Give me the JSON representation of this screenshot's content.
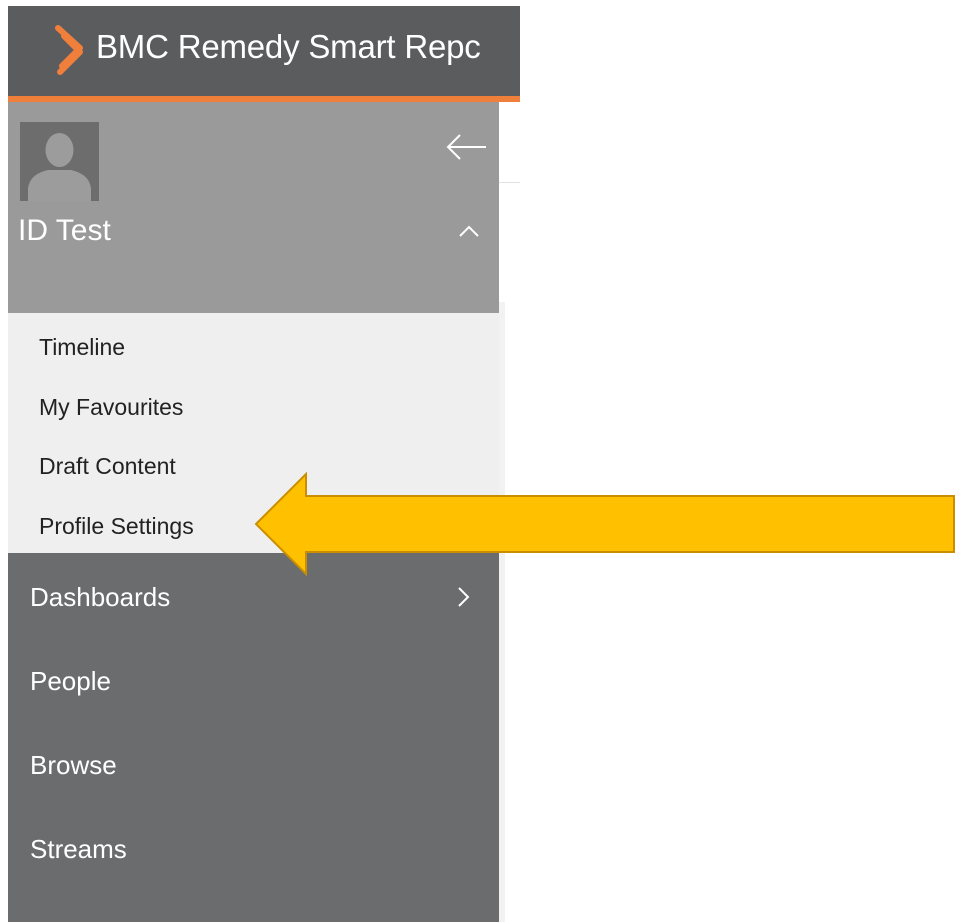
{
  "header": {
    "app_title": "BMC Remedy Smart Repc",
    "logo_icon": "bmc-chevron-logo-icon",
    "bar_color": "#5b5c5e",
    "accent_color": "#f07f3c"
  },
  "profile": {
    "user_name": "ID Test",
    "avatar_icon": "user-silhouette-icon",
    "collapse_icon": "arrow-left-icon",
    "toggle_icon": "chevron-up-icon"
  },
  "submenu": {
    "items": [
      {
        "label": "Timeline"
      },
      {
        "label": "My Favourites"
      },
      {
        "label": "Draft Content"
      },
      {
        "label": "Profile Settings"
      }
    ]
  },
  "nav": {
    "items": [
      {
        "label": "Dashboards",
        "icon": "chevron-right-icon"
      },
      {
        "label": "People"
      },
      {
        "label": "Browse"
      },
      {
        "label": "Streams"
      }
    ]
  },
  "annotation": {
    "icon": "callout-arrow-left-icon",
    "fill_color": "#ffc000",
    "stroke_color": "#c98f00"
  }
}
